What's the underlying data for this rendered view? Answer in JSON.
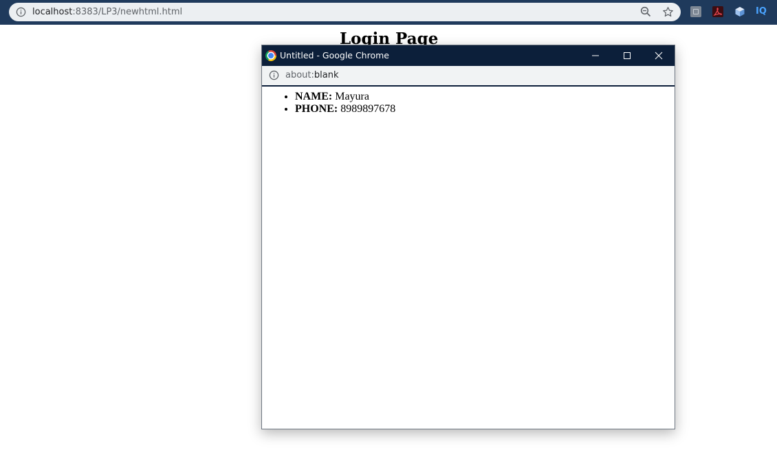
{
  "browser": {
    "url_host": "localhost",
    "url_path": ":8383/LP3/newhtml.html",
    "extensions": {
      "iq_label": "IQ"
    }
  },
  "page": {
    "heading": "Login Page"
  },
  "popup": {
    "title": "Untitled - Google Chrome",
    "url_scheme": "about:",
    "url_rest": "blank",
    "items": [
      {
        "label": "NAME:",
        "value": " Mayura"
      },
      {
        "label": "PHONE:",
        "value": " 8989897678"
      }
    ]
  }
}
